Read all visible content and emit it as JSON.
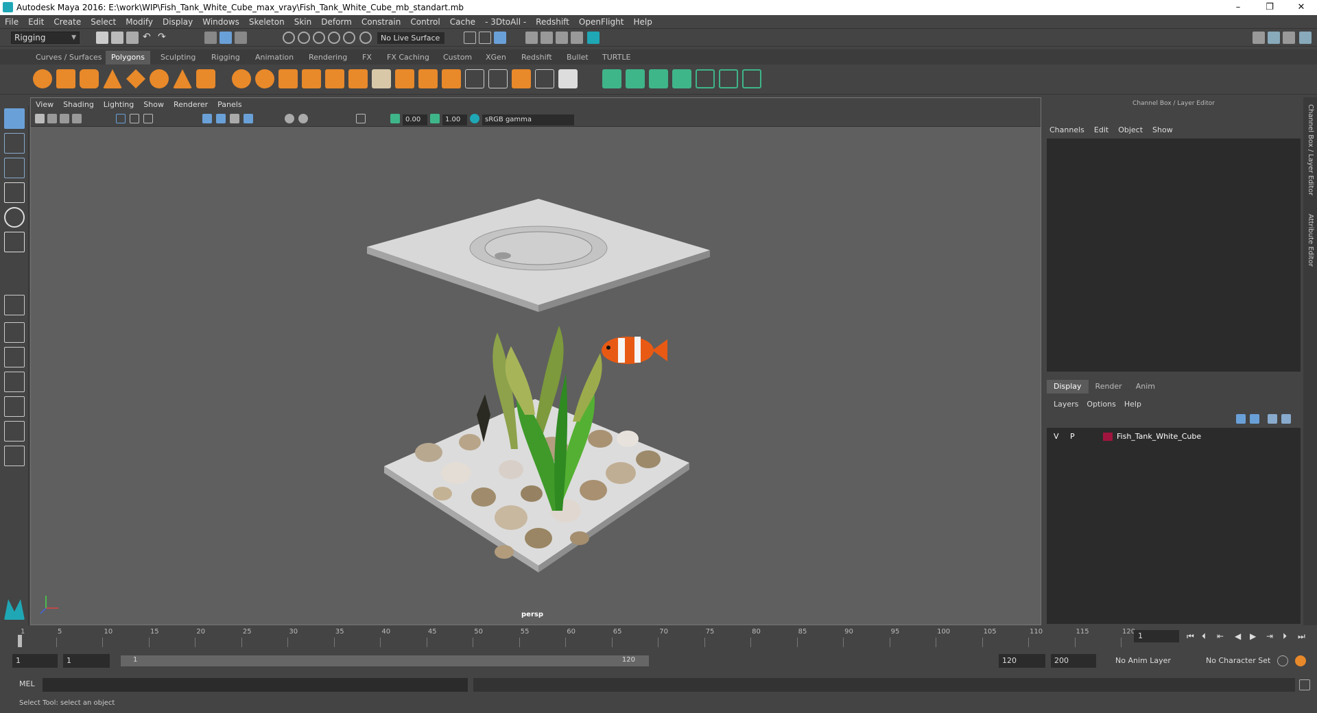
{
  "window": {
    "title": "Autodesk Maya 2016: E:\\work\\WIP\\Fish_Tank_White_Cube_max_vray\\Fish_Tank_White_Cube_mb_standart.mb",
    "minimize": "–",
    "maximize": "❐",
    "close": "✕"
  },
  "menus": [
    "File",
    "Edit",
    "Create",
    "Select",
    "Modify",
    "Display",
    "Windows",
    "Skeleton",
    "Skin",
    "Deform",
    "Constrain",
    "Control",
    "Cache",
    "- 3DtoAll -",
    "Redshift",
    "OpenFlight",
    "Help"
  ],
  "status": {
    "mode": "Rigging",
    "live_surface": "No Live Surface"
  },
  "shelf_tabs": [
    "Curves / Surfaces",
    "Polygons",
    "Sculpting",
    "Rigging",
    "Animation",
    "Rendering",
    "FX",
    "FX Caching",
    "Custom",
    "XGen",
    "Redshift",
    "Bullet",
    "TURTLE"
  ],
  "shelf_active": "Polygons",
  "viewport": {
    "menus": [
      "View",
      "Shading",
      "Lighting",
      "Show",
      "Renderer",
      "Panels"
    ],
    "field1": "0.00",
    "field2": "1.00",
    "colorspace": "sRGB gamma",
    "camera": "persp"
  },
  "channel_box": {
    "title": "Channel Box / Layer Editor",
    "menus": [
      "Channels",
      "Edit",
      "Object",
      "Show"
    ]
  },
  "layer_editor": {
    "tabs": [
      "Display",
      "Render",
      "Anim"
    ],
    "active_tab": "Display",
    "menus": [
      "Layers",
      "Options",
      "Help"
    ],
    "layer": {
      "v": "V",
      "p": "P",
      "name": "Fish_Tank_White_Cube",
      "color": "#a0153e"
    }
  },
  "side_tabs": [
    "Channel Box / Layer Editor",
    "Attribute Editor"
  ],
  "timeline": {
    "ticks": [
      "1",
      "5",
      "10",
      "15",
      "20",
      "25",
      "30",
      "35",
      "40",
      "45",
      "50",
      "55",
      "60",
      "65",
      "70",
      "75",
      "80",
      "85",
      "90",
      "95",
      "100",
      "105",
      "110",
      "115",
      "120"
    ],
    "current_frame": "1"
  },
  "range": {
    "start": "1",
    "playback_start": "1",
    "slider_start": "1",
    "slider_end": "120",
    "playback_end": "120",
    "end": "200",
    "anim_layer": "No Anim Layer",
    "character_set": "No Character Set"
  },
  "command": {
    "label": "MEL"
  },
  "help_line": "Select Tool: select an object"
}
